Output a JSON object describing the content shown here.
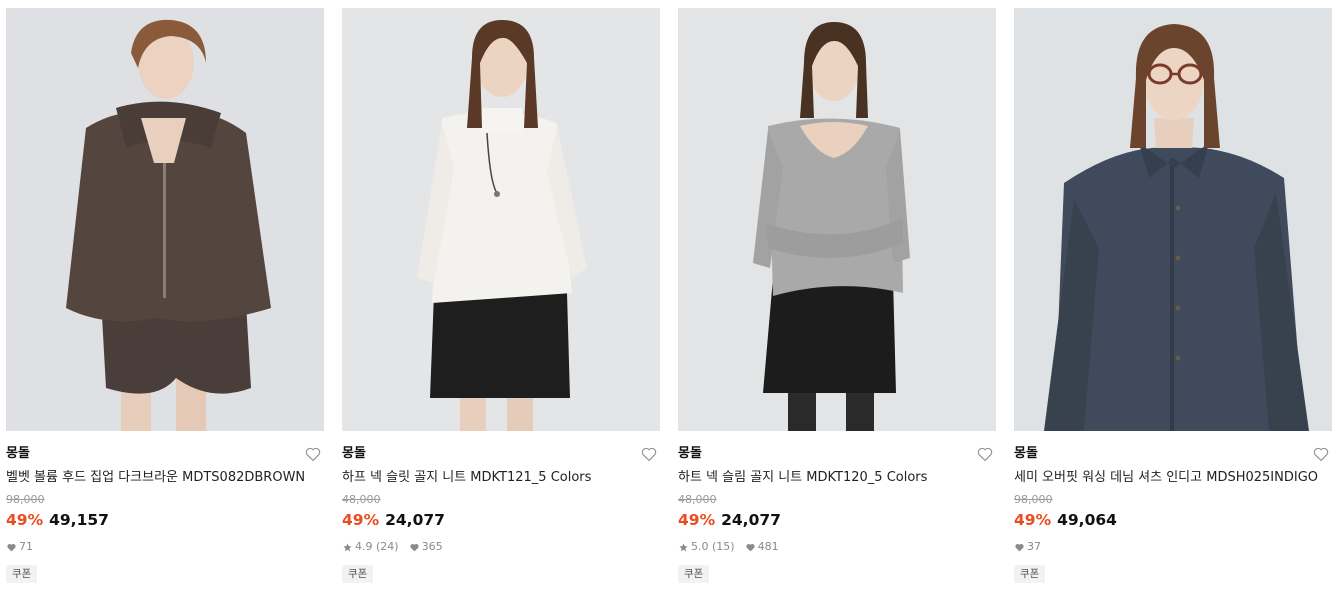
{
  "products": [
    {
      "brand": "몽돌",
      "name": "벨벳 볼륨 후드 집업 다크브라운 MDTS082DBROWN",
      "original_price": "98,000",
      "discount": "49%",
      "price": "49,157",
      "rating": "",
      "review_count": "",
      "likes": "71",
      "badge": "쿠폰",
      "image": "model-brown-velvet-hoodie-zipup"
    },
    {
      "brand": "몽돌",
      "name": "하프 넥 슬릿 골지 니트 MDKT121_5 Colors",
      "original_price": "48,000",
      "discount": "49%",
      "price": "24,077",
      "rating": "4.9",
      "review_count": "(24)",
      "likes": "365",
      "badge": "쿠폰",
      "image": "model-white-ribbed-knit-black-skirt"
    },
    {
      "brand": "몽돌",
      "name": "하트 넥 슬림 골지 니트 MDKT120_5 Colors",
      "original_price": "48,000",
      "discount": "49%",
      "price": "24,077",
      "rating": "5.0",
      "review_count": "(15)",
      "likes": "481",
      "badge": "쿠폰",
      "image": "model-grey-heart-neck-knit-black-skirt"
    },
    {
      "brand": "몽돌",
      "name": "세미 오버핏 워싱 데님 셔츠 인디고 MDSH025INDIGO",
      "original_price": "98,000",
      "discount": "49%",
      "price": "49,064",
      "rating": "",
      "review_count": "",
      "likes": "37",
      "badge": "쿠폰",
      "image": "model-indigo-denim-shirt-glasses"
    }
  ],
  "colors": {
    "discount": "#ef4b1f",
    "original_price": "#9a9a9a",
    "meta": "#8a8a8a",
    "badge_bg": "#f2f2f2"
  }
}
